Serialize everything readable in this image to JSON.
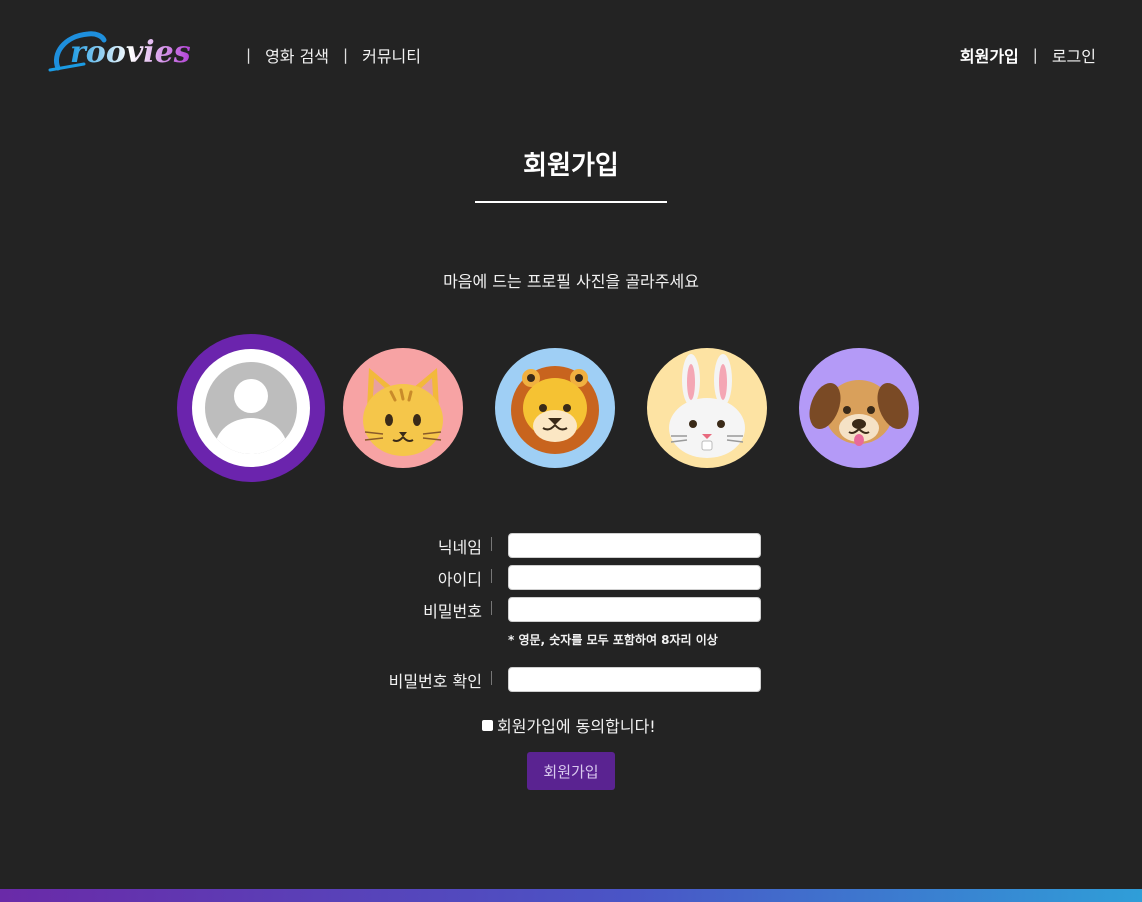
{
  "header": {
    "logo_text": "Groovies",
    "nav_left": [
      {
        "label": "영화 검색"
      },
      {
        "label": "커뮤니티"
      }
    ],
    "nav_right": [
      {
        "label": "회원가입",
        "active": true
      },
      {
        "label": "로그인"
      }
    ]
  },
  "page": {
    "title": "회원가입",
    "subtitle": "마음에 드는 프로필 사진을 골라주세요"
  },
  "avatars": {
    "selected": "default-user-icon",
    "options": [
      "default-user-icon",
      "cat-face-icon",
      "lion-face-icon",
      "rabbit-face-icon",
      "dog-face-icon"
    ],
    "colors": [
      "#6b24ad",
      "#f7a3a4",
      "#9fcff5",
      "#fde3a3",
      "#b49af7"
    ]
  },
  "form": {
    "nickname_label": "닉네임",
    "nickname_value": "",
    "id_label": "아이디",
    "id_value": "",
    "password_label": "비밀번호",
    "password_value": "",
    "password_hint": "* 영문, 숫자를 모두 포함하여 8자리 이상",
    "password_confirm_label": "비밀번호 확인",
    "password_confirm_value": "",
    "agree_label": "회원가입에 동의합니다!",
    "submit_label": "회원가입"
  },
  "colors": {
    "background": "#232323",
    "accent": "#5a2391",
    "selected_ring": "#6b24ad"
  }
}
